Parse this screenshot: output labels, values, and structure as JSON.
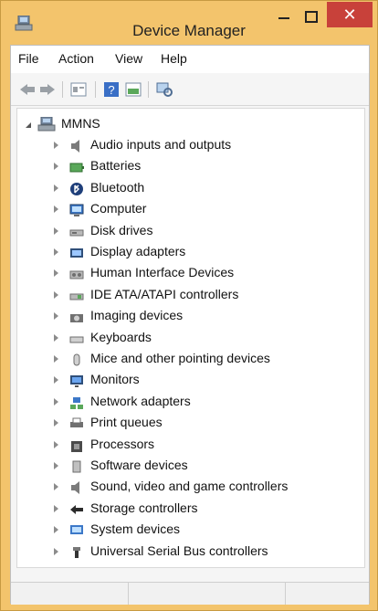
{
  "window": {
    "title": "Device Manager",
    "close_glyph": "✕",
    "accent_color": "#f3c46c",
    "close_color": "#c8413a"
  },
  "menubar": {
    "items": [
      "File",
      "Action",
      "View",
      "Help"
    ]
  },
  "toolbar": {
    "icons": [
      "back-icon",
      "forward-icon",
      "properties-icon",
      "help-icon",
      "update-driver-icon",
      "scan-hardware-icon"
    ]
  },
  "tree": {
    "root": {
      "label": "MMNS",
      "expanded": true
    },
    "items": [
      {
        "label": "Audio inputs and outputs",
        "icon": "speaker-icon"
      },
      {
        "label": "Batteries",
        "icon": "battery-icon"
      },
      {
        "label": "Bluetooth",
        "icon": "bluetooth-icon"
      },
      {
        "label": "Computer",
        "icon": "computer-icon"
      },
      {
        "label": "Disk drives",
        "icon": "disk-drive-icon"
      },
      {
        "label": "Display adapters",
        "icon": "display-adapter-icon"
      },
      {
        "label": "Human Interface Devices",
        "icon": "hid-icon"
      },
      {
        "label": "IDE ATA/ATAPI controllers",
        "icon": "ide-controller-icon"
      },
      {
        "label": "Imaging devices",
        "icon": "camera-icon"
      },
      {
        "label": "Keyboards",
        "icon": "keyboard-icon"
      },
      {
        "label": "Mice and other pointing devices",
        "icon": "mouse-icon"
      },
      {
        "label": "Monitors",
        "icon": "monitor-icon"
      },
      {
        "label": "Network adapters",
        "icon": "network-icon"
      },
      {
        "label": "Print queues",
        "icon": "printer-icon"
      },
      {
        "label": "Processors",
        "icon": "processor-icon"
      },
      {
        "label": "Software devices",
        "icon": "software-device-icon"
      },
      {
        "label": "Sound, video and game controllers",
        "icon": "sound-icon"
      },
      {
        "label": "Storage controllers",
        "icon": "storage-controller-icon"
      },
      {
        "label": "System devices",
        "icon": "system-devices-icon"
      },
      {
        "label": "Universal Serial Bus controllers",
        "icon": "usb-icon"
      }
    ]
  }
}
